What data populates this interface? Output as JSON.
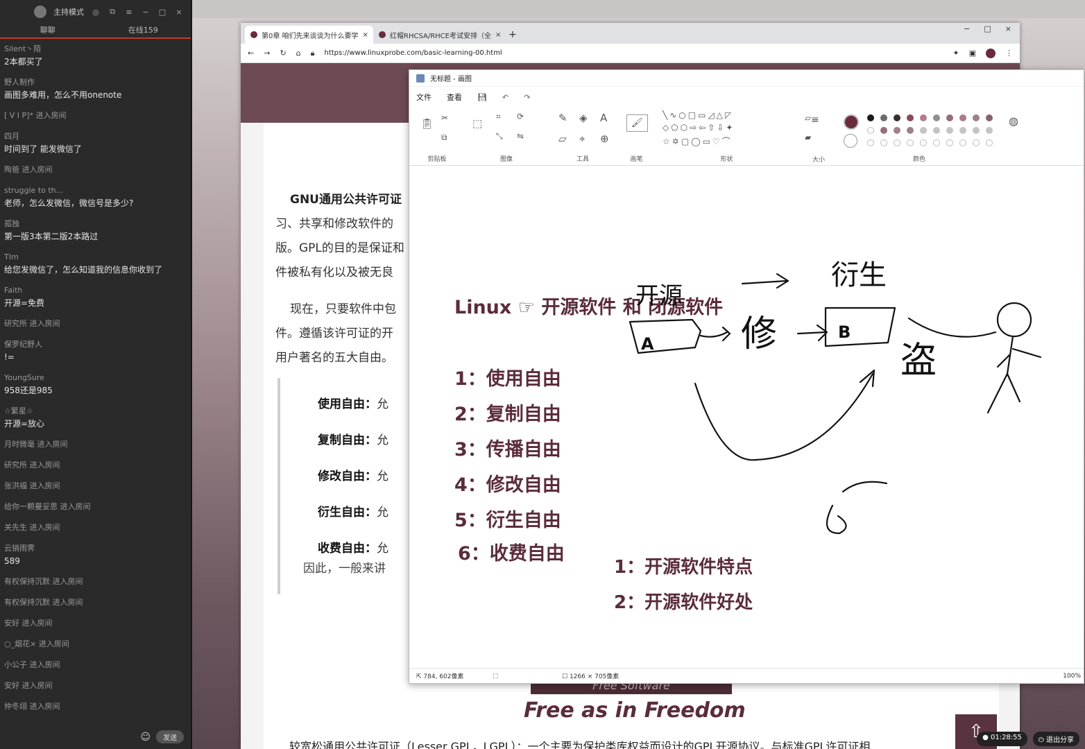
{
  "chat": {
    "mode_label": "主持模式",
    "tabs": [
      "聊聊",
      "在线159"
    ],
    "items": [
      {
        "user": "Silent丶陌",
        "text": "2本都买了"
      },
      {
        "user": "野人制作",
        "text": "画图多难用，怎么不用onenote"
      },
      {
        "join": "[ V I P]* 进入房间"
      },
      {
        "user": "四月",
        "text": "时间到了 能发微信了"
      },
      {
        "join": "陶爸 进入房间"
      },
      {
        "user": "struggle to th...",
        "text": "老师，怎么发微信，微信号是多少?"
      },
      {
        "user": "孤独",
        "text": "第一版3本第二版2本路过"
      },
      {
        "user": "TIm",
        "text": "给您发微信了，怎么知道我的信息你收到了"
      },
      {
        "user": "Faith",
        "text": "开源=免费"
      },
      {
        "join": "研究所 进入房间"
      },
      {
        "user": "保罗纪野人",
        "text": "!="
      },
      {
        "user": "YoungSure",
        "text": "958还是985"
      },
      {
        "user": "☆繁星☆",
        "text": "开源=放心"
      },
      {
        "join": "月时微毫 进入房间"
      },
      {
        "join": "研究所 进入房间"
      },
      {
        "join": "张洪福 进入房间"
      },
      {
        "join": "给你一颗曼妥思 进入房间"
      },
      {
        "join": "关先生 进入房间"
      },
      {
        "user": "云销雨霁",
        "text": "589"
      },
      {
        "join": "有权保持沉默 进入房间"
      },
      {
        "join": "有权保持沉默 进入房间"
      },
      {
        "join": "安好 进入房间"
      },
      {
        "join": "○_烟花× 进入房间"
      },
      {
        "join": "小公子 进入房间"
      },
      {
        "join": "安好 进入房间"
      },
      {
        "join": "仲冬翊 进入房间"
      }
    ],
    "send_label": "发送"
  },
  "browser": {
    "tabs": [
      "第0章 咱们先来谈谈为什么要学",
      "红帽RHCSA/RHCE考试安排（全"
    ],
    "url": "https://www.linuxprobe.com/basic-learning-00.html",
    "paragraph_lines": [
      "GNU通用公共许可证",
      "习、共享和修改软件的",
      "版。GPL的目的是保证和",
      "件被私有化以及被无良",
      "现在，只要软件中包",
      "件。遵循该许可证的开",
      "用户著名的五大自由。"
    ],
    "quote_items": [
      {
        "term": "使用自由：",
        "text": "允"
      },
      {
        "term": "复制自由：",
        "text": "允"
      },
      {
        "term": "修改自由：",
        "text": "允"
      },
      {
        "term": "衍生自由：",
        "text": "允"
      },
      {
        "term": "收费自由：",
        "text": "允"
      }
    ],
    "quote_end": "因此，一般来讲",
    "free_software_band": "Free Software",
    "free_title": "Free as in Freedom",
    "bottom_text": "较宽松通用公共许可证（Lesser GPL，LGPL）：一个主要为保护类库权益而设计的GPL开源协议。与标准GPL许可证相"
  },
  "paint": {
    "title": "无标题 - 画图",
    "menu": [
      "文件",
      "查看"
    ],
    "groups": [
      "剪贴板",
      "图像",
      "工具",
      "画笔",
      "形状",
      "大小",
      "颜色"
    ],
    "colors": [
      "#1a1a1a",
      "#6b6b6b",
      "#3d2a2f",
      "#8b4a5c",
      "#b07d8d",
      "#8f8f8f",
      "#9b6b7b",
      "#a87c8c",
      "#9e8088",
      "#8a6070"
    ],
    "canvas": {
      "title_prefix": "Linux",
      "title_rest": "开源软件 和 闭源软件",
      "freedoms": [
        "1：使用自由",
        "2：复制自由",
        "3：传播自由",
        "4：修改自由",
        "5：衍生自由",
        "6：收费自由"
      ],
      "points": [
        "1：开源软件特点",
        "2：开源软件好处"
      ],
      "sketch_labels": {
        "kaiyuan": "开源",
        "yansheng": "衍生",
        "xiu": "修",
        "dao": "盗",
        "a": "A",
        "b": "B",
        "six": "6"
      }
    },
    "status": {
      "cursor": "784, 602像素",
      "size": "1266 × 705像素",
      "zoom": "100%"
    }
  },
  "taskbar": {
    "timer": "01:28:55",
    "exit_share": "退出分享"
  }
}
